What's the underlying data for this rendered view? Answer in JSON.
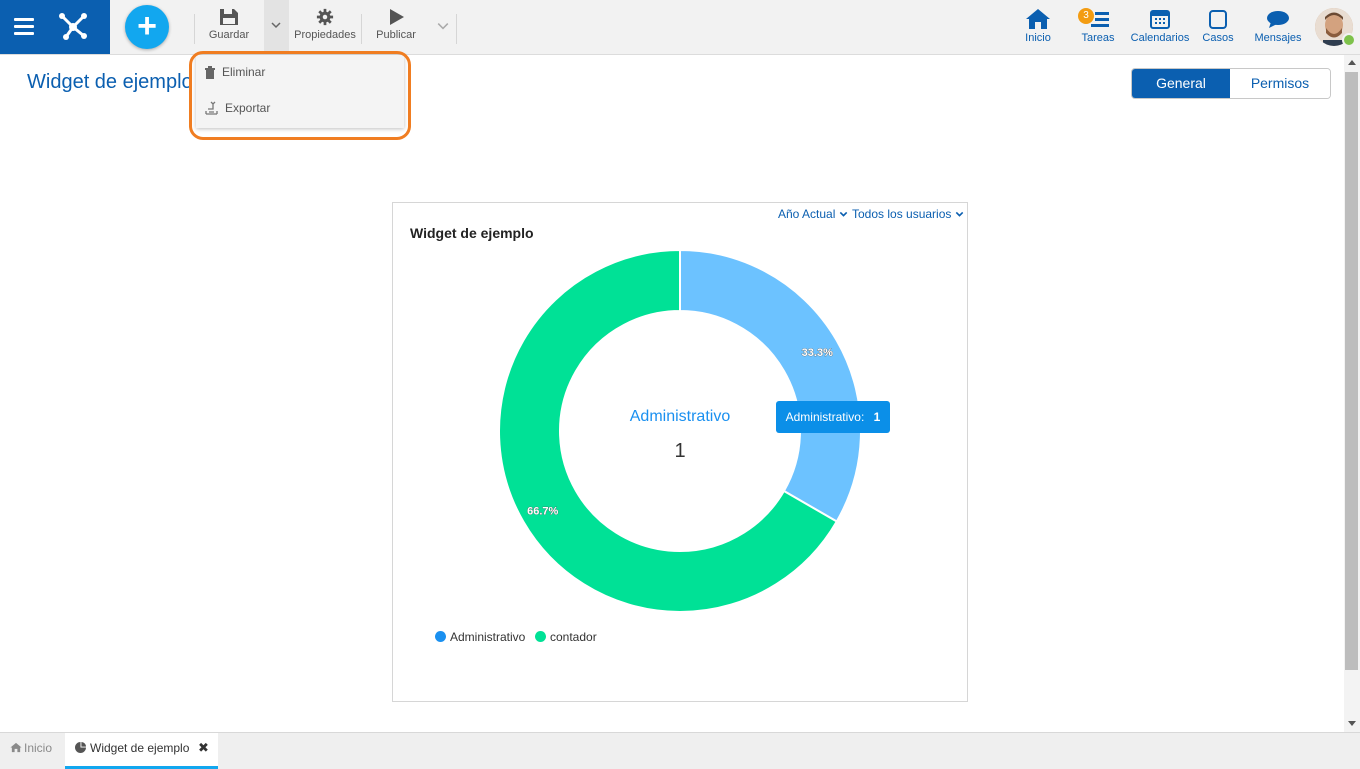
{
  "toolbar": {
    "save_label": "Guardar",
    "properties_label": "Propiedades",
    "publish_label": "Publicar"
  },
  "nav": {
    "home": "Inicio",
    "tasks": "Tareas",
    "tasks_badge": "3",
    "calendars": "Calendarios",
    "cases": "Casos",
    "messages": "Mensajes"
  },
  "dropdown": {
    "items": [
      {
        "label": "Eliminar",
        "icon": "trash-icon"
      },
      {
        "label": "Exportar",
        "icon": "export-icon"
      }
    ]
  },
  "page": {
    "title": "Widget de ejemplo",
    "tabs": [
      {
        "label": "General",
        "active": true
      },
      {
        "label": "Permisos",
        "active": false
      }
    ]
  },
  "widget": {
    "title": "Widget de ejemplo",
    "filter_period": "Año Actual",
    "filter_users": "Todos los usuarios",
    "center_label": "Administrativo",
    "center_value": "1",
    "tooltip_label": "Administrativo:",
    "tooltip_value": "1"
  },
  "chart_data": {
    "type": "pie",
    "categories": [
      "Administrativo",
      "contador"
    ],
    "values": [
      1,
      2
    ],
    "labels": [
      "33.3%",
      "66.7%"
    ],
    "colors": [
      "#6cc2ff",
      "#00e196"
    ],
    "legend_colors": [
      "#1a90f0",
      "#00e196"
    ],
    "legend": "bottom-left",
    "donut": true
  },
  "bottom_tabs": [
    {
      "label": "Inicio",
      "icon": "home-icon"
    },
    {
      "label": "Widget de ejemplo",
      "icon": "pie-chart-icon"
    }
  ],
  "colors": {
    "brand": "#0b5fb0",
    "accent": "#12a7ef",
    "highlight": "#f07d21"
  }
}
